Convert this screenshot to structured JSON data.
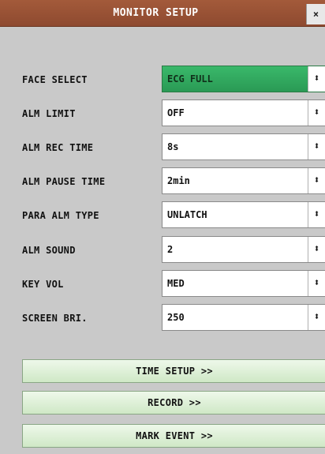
{
  "window": {
    "title": "MONITOR SETUP",
    "close_label": "×"
  },
  "settings": [
    {
      "label": "FACE SELECT",
      "value": "ECG FULL"
    },
    {
      "label": "ALM LIMIT",
      "value": "OFF"
    },
    {
      "label": "ALM REC TIME",
      "value": "8s"
    },
    {
      "label": "ALM PAUSE TIME",
      "value": "2min"
    },
    {
      "label": "PARA ALM TYPE",
      "value": "UNLATCH"
    },
    {
      "label": "ALM SOUND",
      "value": "2"
    },
    {
      "label": "KEY VOL",
      "value": "MED"
    },
    {
      "label": "SCREEN BRI.",
      "value": "250"
    }
  ],
  "arrows_glyph": "⬍",
  "buttons": {
    "time_setup": "TIME SETUP >>",
    "record": "RECORD >>",
    "mark_event": "MARK EVENT >>"
  },
  "colors": {
    "title_bar": "#9a5234",
    "active_select": "#33aa60",
    "button_bg": "#e2f2dc",
    "panel_bg": "#c9c9c9"
  },
  "icons": {
    "close": "close-icon",
    "updown": "updown-arrows-icon"
  }
}
